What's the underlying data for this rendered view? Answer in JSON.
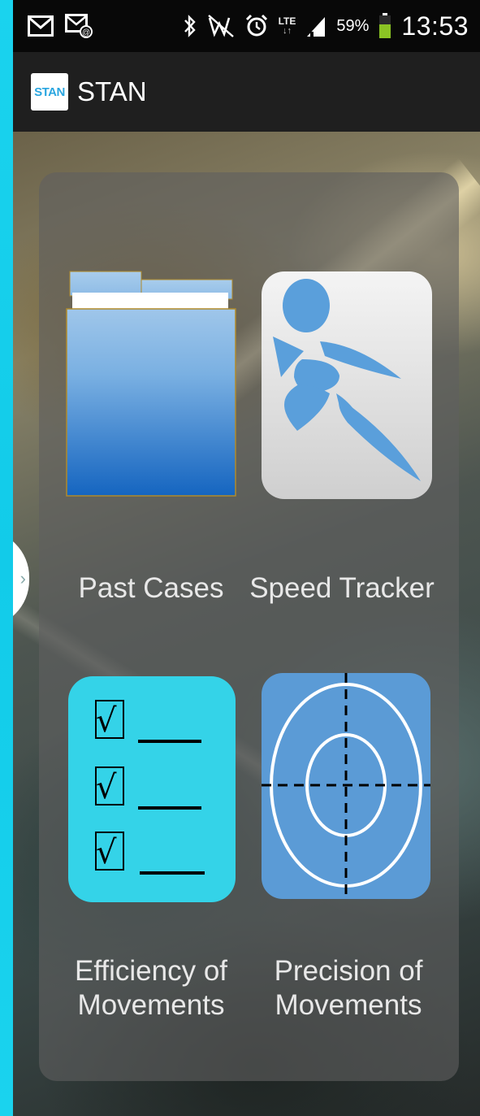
{
  "status_bar": {
    "battery_percent": "59%",
    "time": "13:53",
    "lte_label": "LTE",
    "icons": [
      "gmail-icon",
      "sms-icon",
      "bluetooth-icon",
      "mute-icon",
      "alarm-icon",
      "lte-icon",
      "signal-icon",
      "battery-icon"
    ]
  },
  "action_bar": {
    "logo_text": "STAN",
    "title": "STAN"
  },
  "tiles": [
    {
      "label": "Past Cases",
      "icon": "folder-icon"
    },
    {
      "label": "Speed Tracker",
      "icon": "runner-icon"
    },
    {
      "label": "Efficiency of Movements",
      "icon": "checklist-icon"
    },
    {
      "label": "Precision of Movements",
      "icon": "target-icon"
    }
  ],
  "colors": {
    "screen_edge": "#1ad3ee",
    "folder_blue": "#2a76c9",
    "runner_blue": "#5a9fdb",
    "checklist_cyan": "#34d3e8",
    "target_blue": "#5b9bd6"
  }
}
